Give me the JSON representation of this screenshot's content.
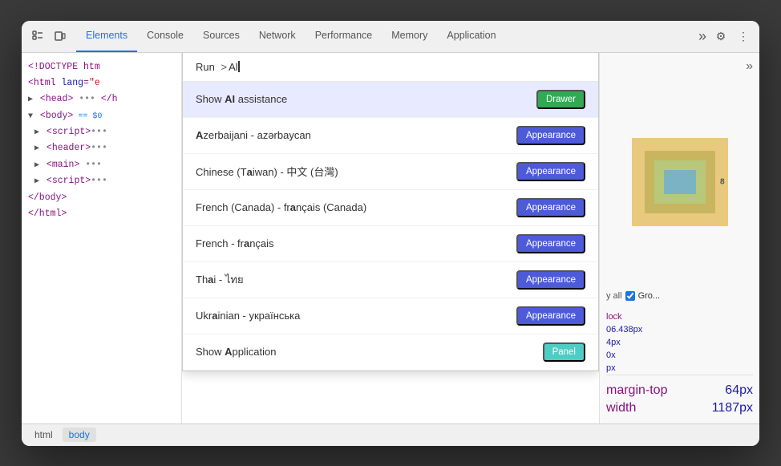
{
  "devtools": {
    "tabs": [
      {
        "id": "elements",
        "label": "Elements",
        "active": true
      },
      {
        "id": "console",
        "label": "Console",
        "active": false
      },
      {
        "id": "sources",
        "label": "Sources",
        "active": false
      },
      {
        "id": "network",
        "label": "Network",
        "active": false
      },
      {
        "id": "performance",
        "label": "Performance",
        "active": false
      },
      {
        "id": "memory",
        "label": "Memory",
        "active": false
      },
      {
        "id": "application",
        "label": "Application",
        "active": false
      }
    ],
    "tab_overflow_label": "»",
    "settings_icon": "⚙",
    "more_icon": "⋮"
  },
  "left_panel": {
    "lines": [
      {
        "text": "<!DOCTYPE htm",
        "indent": 0,
        "selected": false
      },
      {
        "text": "<html lang=\"e",
        "indent": 0,
        "selected": false
      },
      {
        "text": "▶ <head> ••• </h",
        "indent": 0,
        "selected": false
      },
      {
        "text": "▼ <body> == $0",
        "indent": 0,
        "selected": false
      },
      {
        "text": "▶ <script>•••",
        "indent": 1,
        "selected": false
      },
      {
        "text": "▶ <header>•••",
        "indent": 1,
        "selected": false
      },
      {
        "text": "▶ <main> •••",
        "indent": 1,
        "selected": false
      },
      {
        "text": "▶ <script>•••",
        "indent": 1,
        "selected": false
      },
      {
        "text": "</body>",
        "indent": 0,
        "selected": false
      },
      {
        "text": "</html>",
        "indent": 0,
        "selected": false
      }
    ]
  },
  "command_palette": {
    "run_label": "Run",
    "input_value": ">Al",
    "results": [
      {
        "id": "show-ai",
        "label": "Show AI assistance",
        "bold_chars": [
          "A",
          "I"
        ],
        "badge": "Drawer",
        "badge_type": "drawer",
        "highlighted": true
      },
      {
        "id": "azerbaijani",
        "label": "Azerbaijani - azərbaycan",
        "bold_chars": [
          "A"
        ],
        "badge": "Appearance",
        "badge_type": "appearance",
        "highlighted": false
      },
      {
        "id": "chinese-taiwan",
        "label": "Chinese (Taiwan) - 中文 (台灣)",
        "bold_chars": [
          "a"
        ],
        "badge": "Appearance",
        "badge_type": "appearance",
        "highlighted": false
      },
      {
        "id": "french-canada",
        "label": "French (Canada) - français (Canada)",
        "bold_chars": [
          "a"
        ],
        "badge": "Appearance",
        "badge_type": "appearance",
        "highlighted": false
      },
      {
        "id": "french",
        "label": "French - français",
        "bold_chars": [
          "a"
        ],
        "badge": "Appearance",
        "badge_type": "appearance",
        "highlighted": false
      },
      {
        "id": "thai",
        "label": "Thai - ไทย",
        "bold_chars": [
          "a"
        ],
        "badge": "Appearance",
        "badge_type": "appearance",
        "highlighted": false
      },
      {
        "id": "ukrainian",
        "label": "Ukrainian - українська",
        "bold_chars": [
          "A"
        ],
        "badge": "Appearance",
        "badge_type": "appearance",
        "highlighted": false
      },
      {
        "id": "show-application",
        "label": "Show Application",
        "bold_chars": [
          "A"
        ],
        "badge": "Panel",
        "badge_type": "panel",
        "highlighted": false
      }
    ]
  },
  "right_panel": {
    "expand_icon": "»",
    "box_model": {
      "margin_label": "8",
      "content_label": ""
    },
    "filter_label": "Gro...",
    "properties": [
      {
        "name": "lock",
        "value": ""
      },
      {
        "name": "06.438px",
        "value": ""
      },
      {
        "name": "4px",
        "value": ""
      },
      {
        "name": "0x",
        "value": ""
      },
      {
        "name": "px",
        "value": ""
      }
    ],
    "styles": [
      {
        "name": "margin-top",
        "value": "64px"
      },
      {
        "name": "width",
        "value": "1187px"
      }
    ]
  },
  "bottom_bar": {
    "items": [
      {
        "label": "html",
        "active": false
      },
      {
        "label": "body",
        "active": true
      }
    ]
  }
}
